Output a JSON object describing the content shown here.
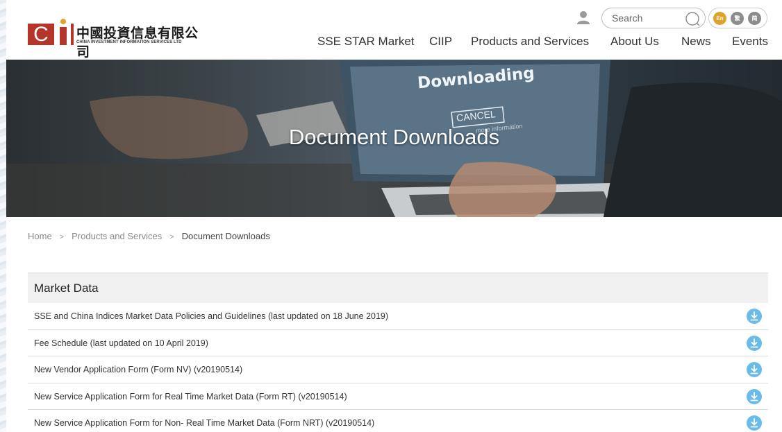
{
  "header": {
    "logo_cn": "中國投資信息有限公司",
    "logo_en": "CHINA INVESTMENT INFORMATION SERVICES LTD",
    "search": {
      "placeholder": "Search"
    },
    "languages": [
      "En",
      "繁",
      "简"
    ],
    "nav": [
      "SSE STAR Market",
      "CIIP",
      "Products and Services",
      "About Us",
      "News",
      "Events"
    ]
  },
  "hero": {
    "title": "Document Downloads",
    "screen_text": "Downloading",
    "cancel_text": "CANCEL",
    "more_info_text": "more information"
  },
  "breadcrumb": {
    "items": [
      "Home",
      "Products and Services"
    ],
    "separator": ">",
    "current": "Document Downloads"
  },
  "section": {
    "title": "Market Data",
    "documents": [
      "SSE and China Indices Market Data Policies and Guidelines (last updated on 18 June 2019)",
      "Fee Schedule (last updated on 10 April 2019)",
      "New Vendor Application Form (Form NV) (v20190514)",
      "New Service Application Form for Real Time Market Data (Form RT) (v20190514)",
      "New Service Application Form for Non- Real Time Market Data (Form NRT) (v20190514)"
    ]
  },
  "colors": {
    "brand_red": "#b5352a",
    "brand_gold": "#e0a22a",
    "download_blue": "#6bbbe8"
  }
}
